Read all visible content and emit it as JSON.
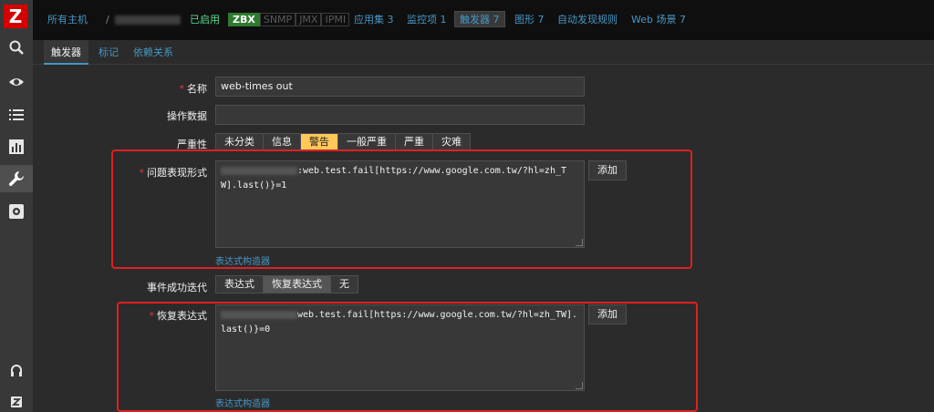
{
  "sidebar": {
    "logo": "Z",
    "icons": [
      "search-icon",
      "eye-icon",
      "list-icon",
      "chart-icon",
      "wrench-icon",
      "gear-icon",
      "headset-icon",
      "user-z-icon"
    ]
  },
  "topbar": {
    "all_hosts": "所有主机",
    "sep": "/",
    "enabled": "已启用",
    "zbx": "ZBX",
    "snmp": "SNMP",
    "jmx": "JMX",
    "ipmi": "IPMI",
    "apps": "应用集 3",
    "items": "监控项 1",
    "triggers": "触发器 7",
    "graphs": "图形 7",
    "discovery": "自动发现规则",
    "web": "Web 场景 7"
  },
  "tabs": {
    "trigger": "触发器",
    "tags": "标记",
    "deps": "依赖关系"
  },
  "form": {
    "name_label": "名称",
    "name_value": "web-times out",
    "opdata_label": "操作数据",
    "opdata_value": "",
    "severity_label": "严重性",
    "severities": [
      "未分类",
      "信息",
      "警告",
      "一般严重",
      "严重",
      "灾难"
    ],
    "severity_selected": "警告",
    "problem_label": "问题表现形式",
    "problem_expr": ":web.test.fail[https://www.google.com.tw/?hl=zh_TW].last()}=1",
    "add_label": "添加",
    "builder_link": "表达式构造器",
    "ok_event_label": "事件成功迭代",
    "ok_event_options": [
      "表达式",
      "恢复表达式",
      "无"
    ],
    "ok_event_selected": "恢复表达式",
    "recovery_label": "恢复表达式",
    "recovery_expr": "web.test.fail[https://www.google.com.tw/?hl=zh_TW].last()}=0"
  },
  "colors": {
    "accent": "#4796c4",
    "enabled": "#59db8f",
    "warning": "#ffc859",
    "required": "#e33734",
    "highlight_box": "#e02020"
  }
}
